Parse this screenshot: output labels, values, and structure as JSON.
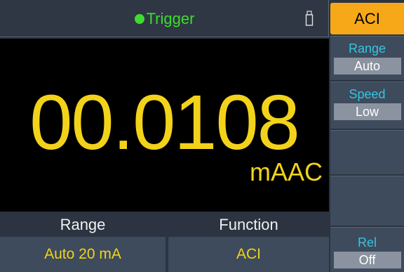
{
  "status": {
    "trigger_label": "Trigger"
  },
  "readout": {
    "value": "00.0108",
    "unit": "mAAC"
  },
  "bottom": {
    "range_label": "Range",
    "range_value": "Auto 20 mA",
    "function_label": "Function",
    "function_value": "ACI"
  },
  "softkeys": {
    "title": "ACI",
    "range": {
      "label": "Range",
      "value": "Auto"
    },
    "speed": {
      "label": "Speed",
      "value": "Low"
    },
    "rel": {
      "label": "Rel",
      "value": "Off"
    }
  },
  "colors": {
    "accent": "#f7a818",
    "reading": "#f2d31a",
    "trigger": "#3ddc2d",
    "softkey_label": "#36c5e0"
  },
  "icons": [
    "trigger-indicator-dot",
    "usb-icon"
  ]
}
